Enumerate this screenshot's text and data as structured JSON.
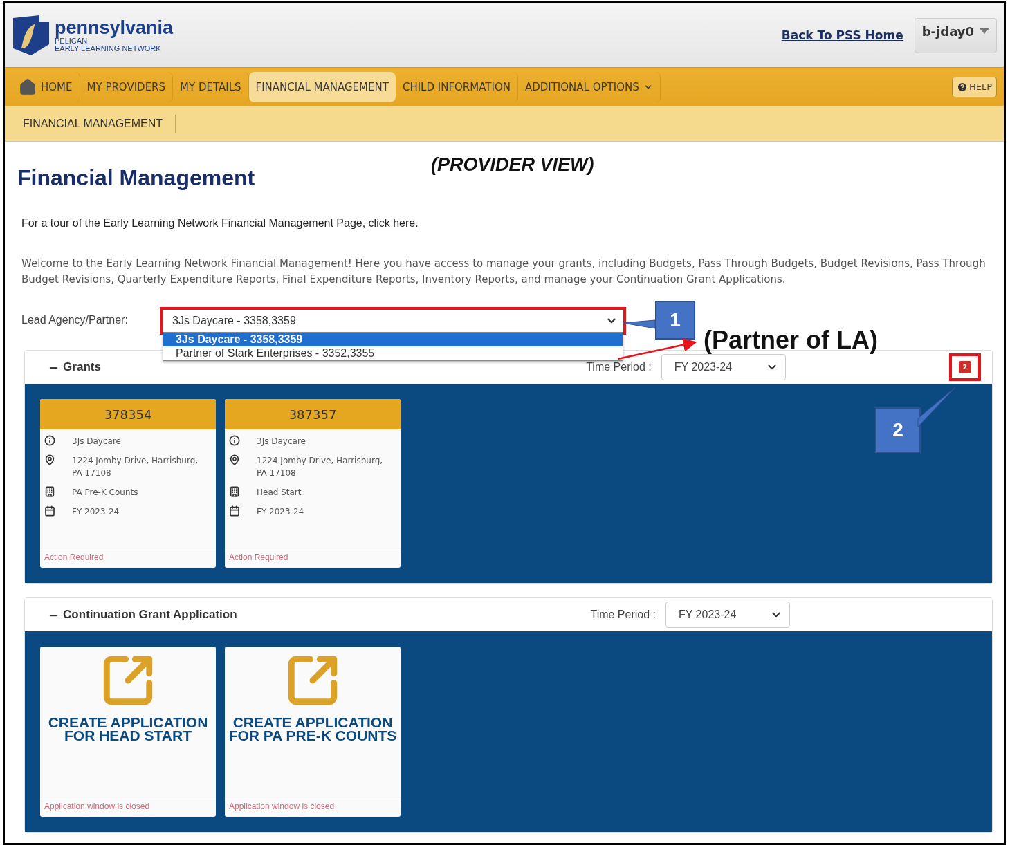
{
  "annotations": {
    "view_label": "(PROVIDER VIEW)",
    "partner_label": "(Partner of LA)",
    "callouts": [
      "1",
      "2"
    ]
  },
  "header": {
    "logo_title": "pennsylvania",
    "logo_line_1": "PELICAN",
    "logo_line_2": "EARLY LEARNING NETWORK",
    "back_link": "Back To PSS Home",
    "user_menu": "b-jday0"
  },
  "nav": {
    "items": [
      {
        "label": "HOME",
        "kind": "home",
        "selected": false
      },
      {
        "label": "MY PROVIDERS",
        "kind": "link",
        "selected": false
      },
      {
        "label": "MY DETAILS",
        "kind": "link",
        "selected": false
      },
      {
        "label": "FINANCIAL MANAGEMENT",
        "kind": "link",
        "selected": true
      },
      {
        "label": "CHILD INFORMATION",
        "kind": "link",
        "selected": false
      },
      {
        "label": "ADDITIONAL OPTIONS",
        "kind": "menu",
        "selected": false
      }
    ],
    "help": "HELP"
  },
  "subnav": {
    "items": [
      "FINANCIAL MANAGEMENT"
    ]
  },
  "page": {
    "title": "Financial Management",
    "tour_text": "For a tour of the Early Learning Network Financial Management Page,",
    "tour_link": "click here.",
    "welcome": "Welcome to the Early Learning Network Financial Management! Here you have access to manage your grants, including Budgets, Pass Through Budgets, Budget Revisions, Pass Through Budget Revisions, Quarterly Expenditure Reports, Final Expenditure Reports, Inventory Reports, and manage your Continuation Grant Applications."
  },
  "lead_agency": {
    "label": "Lead Agency/Partner:",
    "value": "3Js Daycare - 3358,3359",
    "options": [
      {
        "label": "3Js Daycare - 3358,3359",
        "selected": true
      },
      {
        "label": "Partner of Stark Enterprises - 3352,3355",
        "selected": false
      }
    ]
  },
  "grants": {
    "toggle": "−",
    "title": "Grants",
    "time_period_label": "Time Period :",
    "time_period": "FY 2023-24",
    "badge": "2",
    "cards": [
      {
        "number": "378354",
        "name": "3Js Daycare",
        "address": "1224 Jomby Drive, Harrisburg, PA 17108",
        "program": "PA Pre-K Counts",
        "period": "FY 2023-24",
        "status": "Action Required"
      },
      {
        "number": "387357",
        "name": "3Js Daycare",
        "address": "1224 Jomby Drive, Harrisburg, PA 17108",
        "program": "Head Start",
        "period": "FY 2023-24",
        "status": "Action Required"
      }
    ]
  },
  "continuation": {
    "toggle": "−",
    "title": "Continuation Grant Application",
    "time_period_label": "Time Period :",
    "time_period": "FY 2023-24",
    "cards": [
      {
        "title": "CREATE APPLICATION FOR HEAD START",
        "status": "Application window is closed"
      },
      {
        "title": "CREATE APPLICATION FOR PA PRE-K COUNTS",
        "status": "Application window is closed"
      }
    ]
  }
}
